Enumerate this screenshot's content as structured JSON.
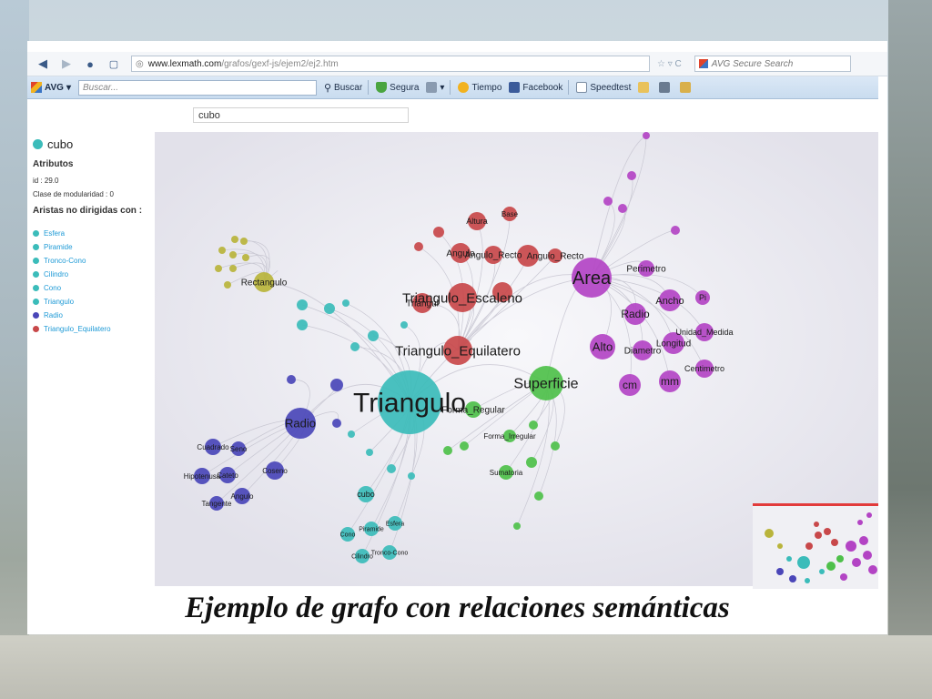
{
  "browser": {
    "url_host": "www.lexmath.com",
    "url_path": "/grafos/gexf-js/ejem2/ej2.htm",
    "url_tools": "☆ ▿ C",
    "search_engine": "AVG Secure Search"
  },
  "toolbar": {
    "brand": "AVG",
    "search_placeholder": "Buscar...",
    "buttons": [
      "Buscar",
      "Segura",
      "Tiempo",
      "Facebook",
      "Speedtest"
    ]
  },
  "app": {
    "search_value": "cubo"
  },
  "sidebar": {
    "node_title": "cubo",
    "attributes_heading": "Atributos",
    "id_line": "id : 29.0",
    "modularity_line": "Clase de modularidad : 0",
    "edges_heading": "Aristas no dirigidas con :",
    "edges": [
      {
        "label": "Esfera",
        "color": "#3bbcba"
      },
      {
        "label": "Piramide",
        "color": "#3bbcba"
      },
      {
        "label": "Tronco-Cono",
        "color": "#3bbcba"
      },
      {
        "label": "Cilindro",
        "color": "#3bbcba"
      },
      {
        "label": "Cono",
        "color": "#3bbcba"
      },
      {
        "label": "Triangulo",
        "color": "#3bbcba"
      },
      {
        "label": "Radio",
        "color": "#4a46b8"
      },
      {
        "label": "Triangulo_Equilatero",
        "color": "#c8484a"
      }
    ]
  },
  "graph": {
    "colors": {
      "cyan": "#3bbcba",
      "red": "#c8484a",
      "purple": "#b344c4",
      "green": "#4ec04a",
      "blue": "#4a46b8",
      "olive": "#b9b43b"
    },
    "labels": {
      "triangulo": "Triangulo",
      "superficie": "Superficie",
      "area": "Area",
      "triangulo_equilatero": "Triangulo_Equilatero",
      "triangulo_escaleno": "Triangulo_Escaleno",
      "triangulo_x": "Triangul",
      "radio": "Radio",
      "radio_purple": "Radio",
      "rectangulo": "Rectangulo",
      "altura": "Altura",
      "base": "Base",
      "angulo_recto": "Angulo_Recto",
      "angulo": "Angulo",
      "angulo_cluster": "Angulo_Recto",
      "perimetro": "Perimetro",
      "ancho": "Ancho",
      "alto": "Alto",
      "diametro": "Diametro",
      "longitud": "Longitud",
      "unidad_medida": "Unidad_Medida",
      "pi": "Pi",
      "cm": "cm",
      "mm": "mm",
      "centimetro": "Centimetro",
      "forma_regular": "Forma_Regular",
      "forma_irregular": "Forma_Irregular",
      "sumatoria": "Sumatoria",
      "cuadrado": "Cuadrado",
      "cateto": "Cateto",
      "seno": "Seno",
      "coseno": "Coseno",
      "hipotenusa": "Hipotenusa",
      "tangente": "Tangente",
      "angulo_blue": "Angulo",
      "cubo": "cubo",
      "cono": "Cono",
      "piramide": "Piramide",
      "esfera": "Esfera",
      "cilindro": "Cilindro",
      "tronco_cono": "Tronco-Cono"
    }
  },
  "caption": "Ejemplo de grafo con relaciones semánticas"
}
